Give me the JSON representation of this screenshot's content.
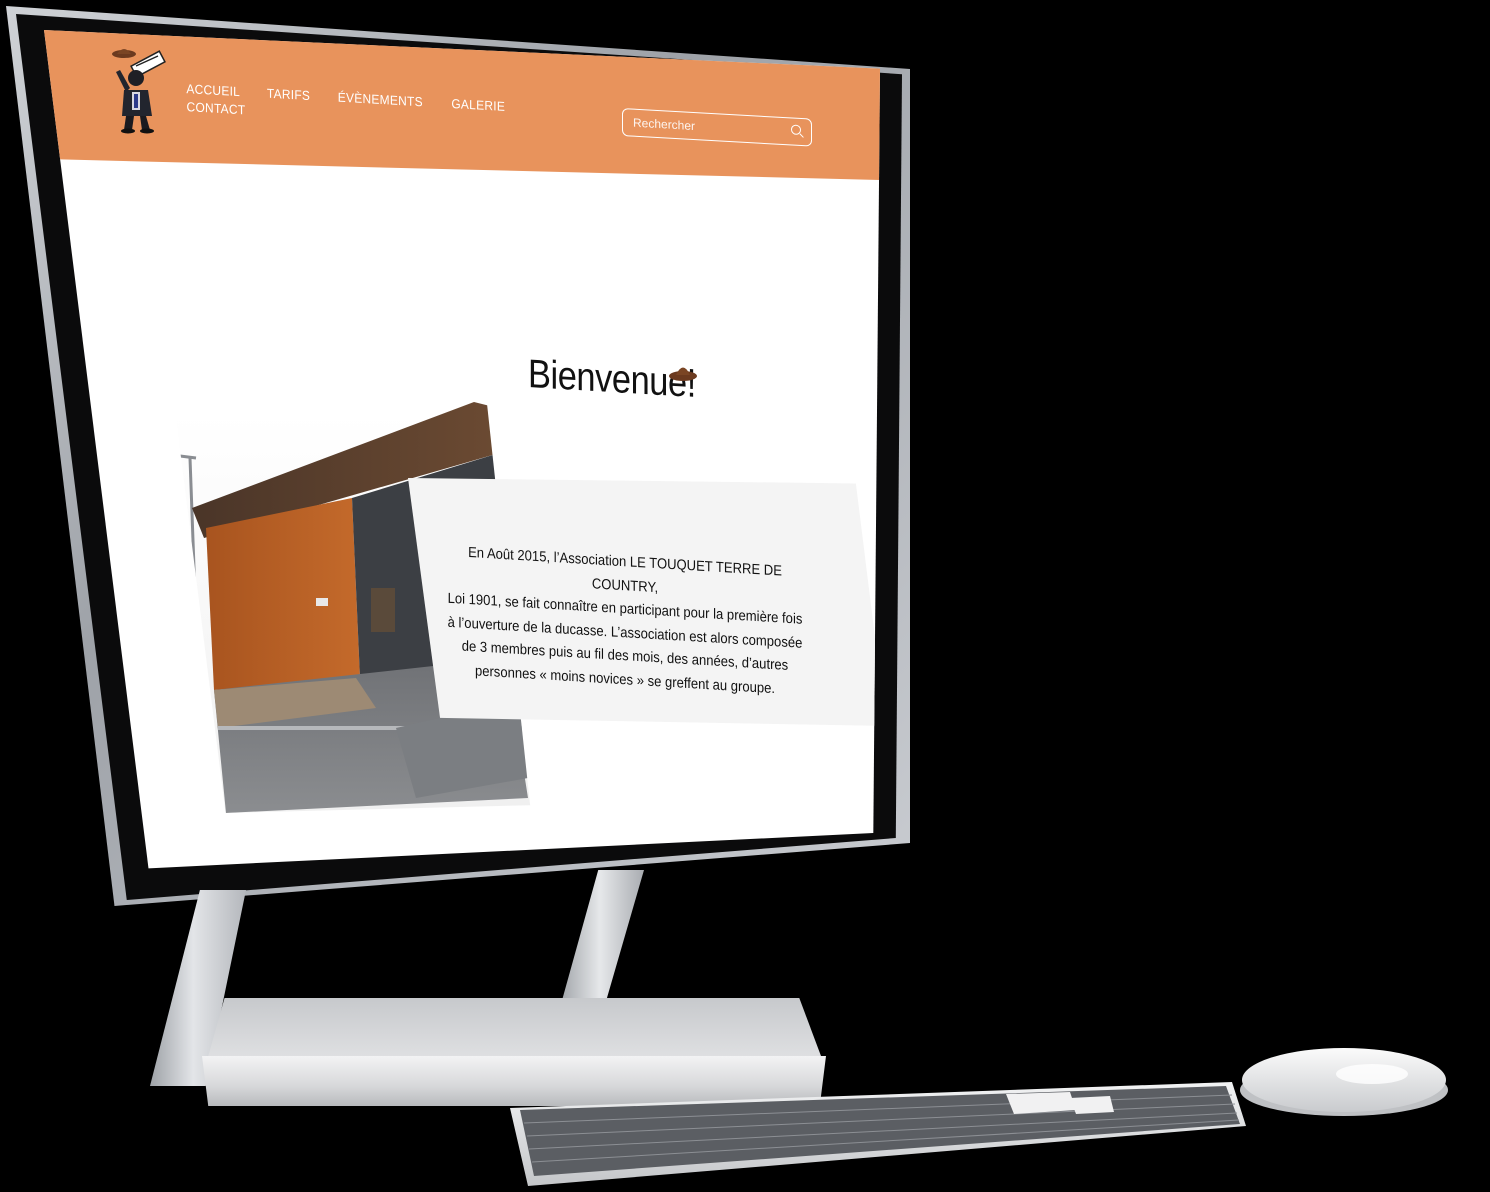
{
  "site": {
    "nav": {
      "items": [
        "ACCUEIL",
        "TARIFS",
        "ÉVÈNEMENTS",
        "GALERIE",
        "CONTACT"
      ]
    },
    "search": {
      "placeholder": "Rechercher"
    },
    "welcome": {
      "title": "Bienvenue!"
    },
    "intro": {
      "lines": [
        "En Août 2015, l’Association LE TOUQUET TERRE DE COUNTRY,",
        "Loi 1901, se fait connaître en participant pour la première fois",
        "à l’ouverture de la ducasse. L’association est alors composée",
        "de 3 membres puis au fil des mois, des années, d’autres",
        "personnes « moins novices » se greffent au groupe."
      ]
    },
    "logo": {
      "icon": "cowboy-mascot-logo"
    },
    "colors": {
      "header": "#e8935c",
      "text": "#111111"
    }
  }
}
